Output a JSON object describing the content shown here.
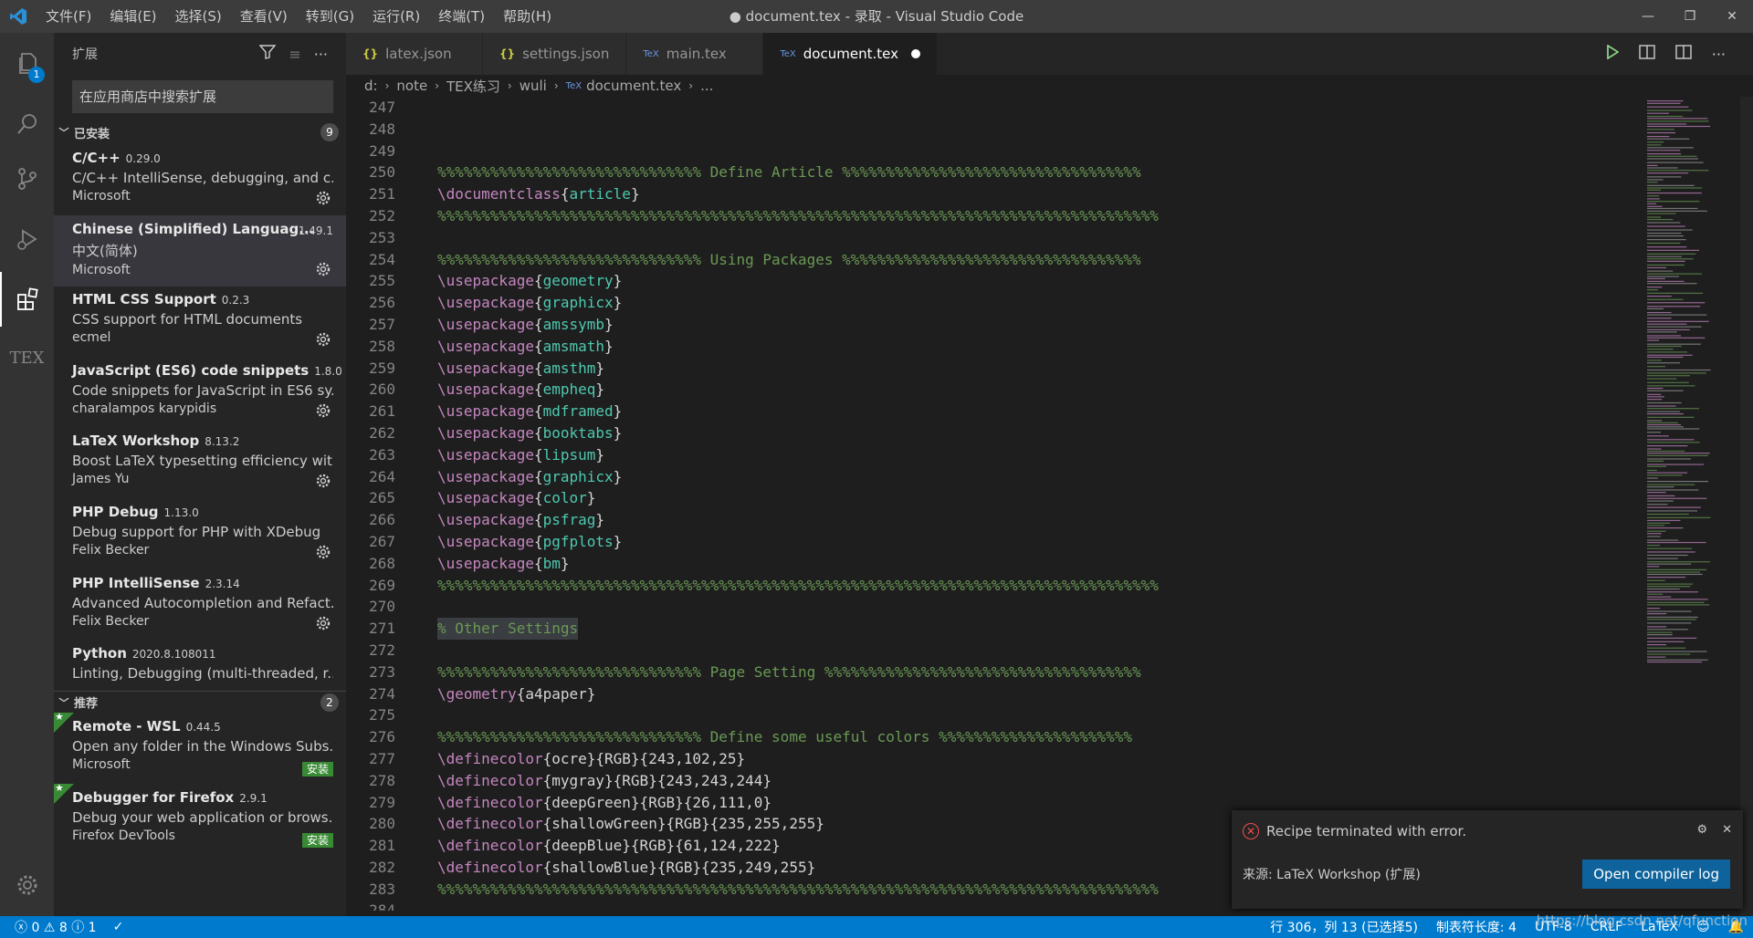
{
  "window": {
    "title": "● document.tex - 录取 - Visual Studio Code"
  },
  "menu": [
    "文件(F)",
    "编辑(E)",
    "选择(S)",
    "查看(V)",
    "转到(G)",
    "运行(R)",
    "终端(T)",
    "帮助(H)"
  ],
  "activity": {
    "explorer_badge": "1",
    "tex_label": "TEX"
  },
  "sidebar": {
    "title": "扩展",
    "search_placeholder": "在应用商店中搜索扩展",
    "installed": {
      "label": "已安装",
      "count": "9"
    },
    "recommended": {
      "label": "推荐",
      "count": "2"
    },
    "extensions": [
      {
        "name": "C/C++",
        "version": "0.29.0",
        "desc": "C/C++ IntelliSense, debugging, and c...",
        "publisher": "Microsoft"
      },
      {
        "name": "Chinese (Simplified) Languag...",
        "version": "1.49.1",
        "desc": "中文(简体)",
        "publisher": "Microsoft"
      },
      {
        "name": "HTML CSS Support",
        "version": "0.2.3",
        "desc": "CSS support for HTML documents",
        "publisher": "ecmel"
      },
      {
        "name": "JavaScript (ES6) code snippets",
        "version": "1.8.0",
        "desc": "Code snippets for JavaScript in ES6 sy...",
        "publisher": "charalampos karypidis"
      },
      {
        "name": "LaTeX Workshop",
        "version": "8.13.2",
        "desc": "Boost LaTeX typesetting efficiency wit...",
        "publisher": "James Yu"
      },
      {
        "name": "PHP Debug",
        "version": "1.13.0",
        "desc": "Debug support for PHP with XDebug",
        "publisher": "Felix Becker"
      },
      {
        "name": "PHP IntelliSense",
        "version": "2.3.14",
        "desc": "Advanced Autocompletion and Refact...",
        "publisher": "Felix Becker"
      },
      {
        "name": "Python",
        "version": "2020.8.108011",
        "desc": "Linting, Debugging (multi-threaded, r..."
      }
    ],
    "recommended_items": [
      {
        "name": "Remote - WSL",
        "version": "0.44.5",
        "desc": "Open any folder in the Windows Subs...",
        "publisher": "Microsoft",
        "install": "安装"
      },
      {
        "name": "Debugger for Firefox",
        "version": "2.9.1",
        "desc": "Debug your web application or brows...",
        "publisher": "Firefox DevTools",
        "install": "安装"
      }
    ]
  },
  "tabs": [
    {
      "label": "latex.json",
      "icon": "{}"
    },
    {
      "label": "settings.json",
      "icon": "{}"
    },
    {
      "label": "main.tex",
      "icon": "TeX"
    },
    {
      "label": "document.tex",
      "icon": "TeX"
    }
  ],
  "breadcrumb": [
    "d:",
    "note",
    "TEX练习",
    "wuli",
    "document.tex",
    "..."
  ],
  "code": [
    {
      "n": "247",
      "parts": []
    },
    {
      "n": "248",
      "parts": []
    },
    {
      "n": "249",
      "parts": []
    },
    {
      "n": "250",
      "parts": [
        [
          "cm",
          "%%%%%%%%%%%%%%%%%%%%%%%%%%%%%% Define Article %%%%%%%%%%%%%%%%%%%%%%%%%%%%%%%%%%"
        ]
      ]
    },
    {
      "n": "251",
      "parts": [
        [
          "kw",
          "\\documentclass"
        ],
        [
          "tx",
          "{"
        ],
        [
          "arg",
          "article"
        ],
        [
          "tx",
          "}"
        ]
      ]
    },
    {
      "n": "252",
      "parts": [
        [
          "cm",
          "%%%%%%%%%%%%%%%%%%%%%%%%%%%%%%%%%%%%%%%%%%%%%%%%%%%%%%%%%%%%%%%%%%%%%%%%%%%%%%%%%%"
        ]
      ]
    },
    {
      "n": "253",
      "parts": []
    },
    {
      "n": "254",
      "parts": [
        [
          "cm",
          "%%%%%%%%%%%%%%%%%%%%%%%%%%%%%% Using Packages %%%%%%%%%%%%%%%%%%%%%%%%%%%%%%%%%%"
        ]
      ]
    },
    {
      "n": "255",
      "parts": [
        [
          "kw",
          "\\usepackage"
        ],
        [
          "tx",
          "{"
        ],
        [
          "arg",
          "geometry"
        ],
        [
          "tx",
          "}"
        ]
      ]
    },
    {
      "n": "256",
      "parts": [
        [
          "kw",
          "\\usepackage"
        ],
        [
          "tx",
          "{"
        ],
        [
          "arg",
          "graphicx"
        ],
        [
          "tx",
          "}"
        ]
      ]
    },
    {
      "n": "257",
      "parts": [
        [
          "kw",
          "\\usepackage"
        ],
        [
          "tx",
          "{"
        ],
        [
          "arg",
          "amssymb"
        ],
        [
          "tx",
          "}"
        ]
      ]
    },
    {
      "n": "258",
      "parts": [
        [
          "kw",
          "\\usepackage"
        ],
        [
          "tx",
          "{"
        ],
        [
          "arg",
          "amsmath"
        ],
        [
          "tx",
          "}"
        ]
      ]
    },
    {
      "n": "259",
      "parts": [
        [
          "kw",
          "\\usepackage"
        ],
        [
          "tx",
          "{"
        ],
        [
          "arg",
          "amsthm"
        ],
        [
          "tx",
          "}"
        ]
      ]
    },
    {
      "n": "260",
      "parts": [
        [
          "kw",
          "\\usepackage"
        ],
        [
          "tx",
          "{"
        ],
        [
          "arg",
          "empheq"
        ],
        [
          "tx",
          "}"
        ]
      ]
    },
    {
      "n": "261",
      "parts": [
        [
          "kw",
          "\\usepackage"
        ],
        [
          "tx",
          "{"
        ],
        [
          "arg",
          "mdframed"
        ],
        [
          "tx",
          "}"
        ]
      ]
    },
    {
      "n": "262",
      "parts": [
        [
          "kw",
          "\\usepackage"
        ],
        [
          "tx",
          "{"
        ],
        [
          "arg",
          "booktabs"
        ],
        [
          "tx",
          "}"
        ]
      ]
    },
    {
      "n": "263",
      "parts": [
        [
          "kw",
          "\\usepackage"
        ],
        [
          "tx",
          "{"
        ],
        [
          "arg",
          "lipsum"
        ],
        [
          "tx",
          "}"
        ]
      ]
    },
    {
      "n": "264",
      "parts": [
        [
          "kw",
          "\\usepackage"
        ],
        [
          "tx",
          "{"
        ],
        [
          "arg",
          "graphicx"
        ],
        [
          "tx",
          "}"
        ]
      ]
    },
    {
      "n": "265",
      "parts": [
        [
          "kw",
          "\\usepackage"
        ],
        [
          "tx",
          "{"
        ],
        [
          "arg",
          "color"
        ],
        [
          "tx",
          "}"
        ]
      ]
    },
    {
      "n": "266",
      "parts": [
        [
          "kw",
          "\\usepackage"
        ],
        [
          "tx",
          "{"
        ],
        [
          "arg",
          "psfrag"
        ],
        [
          "tx",
          "}"
        ]
      ]
    },
    {
      "n": "267",
      "parts": [
        [
          "kw",
          "\\usepackage"
        ],
        [
          "tx",
          "{"
        ],
        [
          "arg",
          "pgfplots"
        ],
        [
          "tx",
          "}"
        ]
      ]
    },
    {
      "n": "268",
      "parts": [
        [
          "kw",
          "\\usepackage"
        ],
        [
          "tx",
          "{"
        ],
        [
          "arg",
          "bm"
        ],
        [
          "tx",
          "}"
        ]
      ]
    },
    {
      "n": "269",
      "parts": [
        [
          "cm",
          "%%%%%%%%%%%%%%%%%%%%%%%%%%%%%%%%%%%%%%%%%%%%%%%%%%%%%%%%%%%%%%%%%%%%%%%%%%%%%%%%%%"
        ]
      ]
    },
    {
      "n": "270",
      "parts": []
    },
    {
      "n": "271",
      "parts": [
        [
          "cmhl",
          "% Other Settings"
        ]
      ]
    },
    {
      "n": "272",
      "parts": []
    },
    {
      "n": "273",
      "parts": [
        [
          "cm",
          "%%%%%%%%%%%%%%%%%%%%%%%%%%%%%% Page Setting %%%%%%%%%%%%%%%%%%%%%%%%%%%%%%%%%%%%"
        ]
      ]
    },
    {
      "n": "274",
      "parts": [
        [
          "kw",
          "\\geometry"
        ],
        [
          "tx",
          "{a4paper}"
        ]
      ]
    },
    {
      "n": "275",
      "parts": []
    },
    {
      "n": "276",
      "parts": [
        [
          "cm",
          "%%%%%%%%%%%%%%%%%%%%%%%%%%%%%% Define some useful colors %%%%%%%%%%%%%%%%%%%%%%"
        ]
      ]
    },
    {
      "n": "277",
      "parts": [
        [
          "kw",
          "\\definecolor"
        ],
        [
          "tx",
          "{ocre}{RGB}{243,102,25}"
        ]
      ]
    },
    {
      "n": "278",
      "parts": [
        [
          "kw",
          "\\definecolor"
        ],
        [
          "tx",
          "{mygray}{RGB}{243,243,244}"
        ]
      ]
    },
    {
      "n": "279",
      "parts": [
        [
          "kw",
          "\\definecolor"
        ],
        [
          "tx",
          "{deepGreen}{RGB}{26,111,0}"
        ]
      ]
    },
    {
      "n": "280",
      "parts": [
        [
          "kw",
          "\\definecolor"
        ],
        [
          "tx",
          "{shallowGreen}{RGB}{235,255,255}"
        ]
      ]
    },
    {
      "n": "281",
      "parts": [
        [
          "kw",
          "\\definecolor"
        ],
        [
          "tx",
          "{deepBlue}{RGB}{61,124,222}"
        ]
      ]
    },
    {
      "n": "282",
      "parts": [
        [
          "kw",
          "\\definecolor"
        ],
        [
          "tx",
          "{shallowBlue}{RGB}{235,249,255}"
        ]
      ]
    },
    {
      "n": "283",
      "parts": [
        [
          "cm",
          "%%%%%%%%%%%%%%%%%%%%%%%%%%%%%%%%%%%%%%%%%%%%%%%%%%%%%%%%%%%%%%%%%%%%%%%%%%%%%%%%%%"
        ]
      ]
    },
    {
      "n": "284",
      "parts": []
    }
  ],
  "notification": {
    "message": "Recipe terminated with error.",
    "source": "来源: LaTeX Workshop (扩展)",
    "button": "Open compiler log"
  },
  "status": {
    "errors": "0",
    "warnings": "8",
    "info": "1",
    "position": "行 306，列 13 (已选择5)",
    "tab_size": "制表符长度: 4",
    "encoding": "UTF-8",
    "eol": "CRLF",
    "language": "LaTeX"
  },
  "watermark": "https://blog.csdn.net/qfunction",
  "colors": {
    "accent": "#007acc",
    "comment": "#6a9955",
    "keyword": "#c586c0",
    "argument": "#4ec9b0"
  }
}
